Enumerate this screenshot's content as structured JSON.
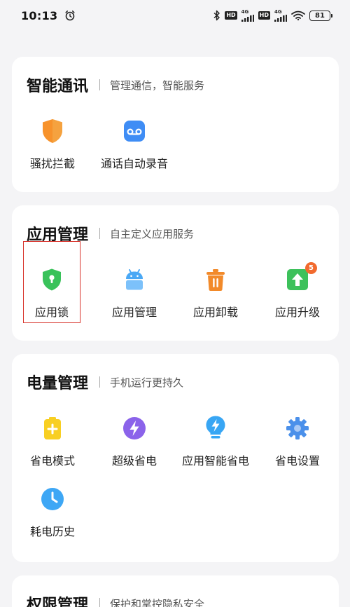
{
  "status_bar": {
    "time": "10:13",
    "alarm_icon": "alarm-clock-icon",
    "bluetooth_icon": "bluetooth-icon",
    "hd1": "HD",
    "net1": "4G",
    "hd2": "HD",
    "net2": "4G",
    "wifi_icon": "wifi-icon",
    "battery": "81"
  },
  "sections": [
    {
      "title": "智能通讯",
      "subtitle": "管理通信，智能服务",
      "items": [
        {
          "label": "骚扰拦截",
          "icon": "shield-icon",
          "color": "#f7922b"
        },
        {
          "label": "通话自动录音",
          "icon": "call-record-icon",
          "color": "#3f8df5"
        }
      ]
    },
    {
      "title": "应用管理",
      "subtitle": "自主定义应用服务",
      "items": [
        {
          "label": "应用锁",
          "icon": "lock-shield-icon",
          "color": "#39c25a"
        },
        {
          "label": "应用管理",
          "icon": "android-icon",
          "color": "#4aa8f5"
        },
        {
          "label": "应用卸载",
          "icon": "trash-icon",
          "color": "#f28a2a"
        },
        {
          "label": "应用升级",
          "icon": "upgrade-icon",
          "color": "#3dc15b",
          "badge": "5"
        }
      ]
    },
    {
      "title": "电量管理",
      "subtitle": "手机运行更持久",
      "items": [
        {
          "label": "省电模式",
          "icon": "battery-plus-icon",
          "color": "#f8cf22"
        },
        {
          "label": "超级省电",
          "icon": "lightning-icon",
          "color": "#8b63ea"
        },
        {
          "label": "应用智能省电",
          "icon": "bulb-icon",
          "color": "#38a6f4"
        },
        {
          "label": "省电设置",
          "icon": "gear-icon",
          "color": "#4b90ea"
        },
        {
          "label": "耗电历史",
          "icon": "clock-icon",
          "color": "#3ea7f5"
        }
      ]
    },
    {
      "title": "权限管理",
      "subtitle": "保护和掌控隐私安全",
      "items": []
    }
  ]
}
